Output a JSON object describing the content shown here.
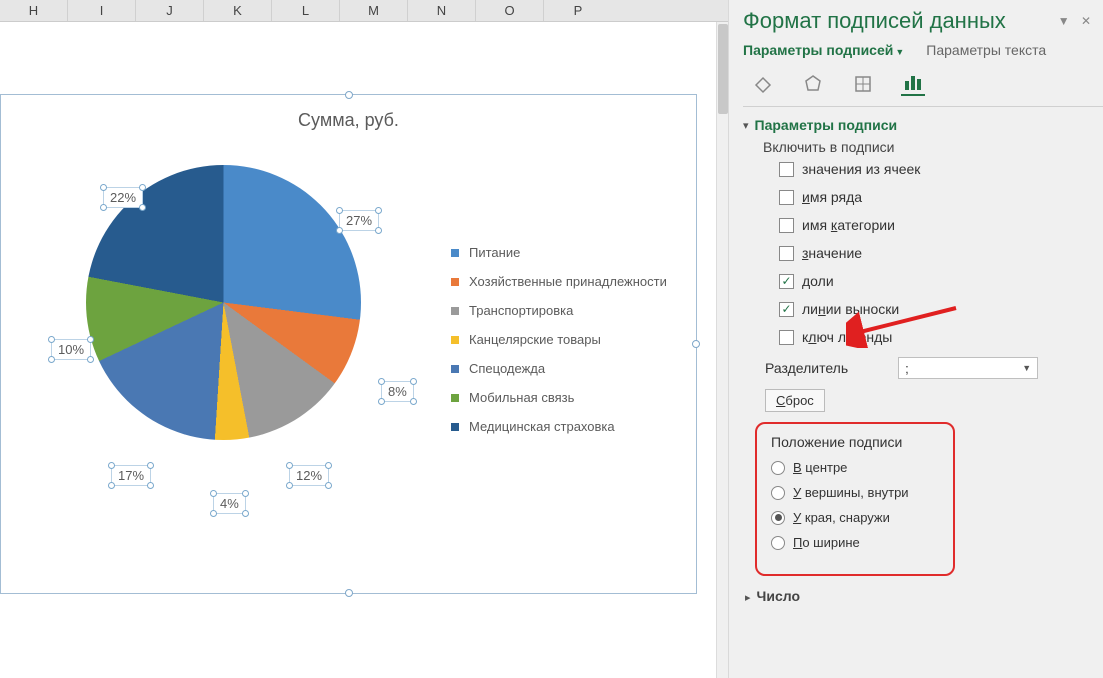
{
  "columns": [
    "H",
    "I",
    "J",
    "K",
    "L",
    "M",
    "N",
    "O",
    "P"
  ],
  "chart_data": {
    "type": "pie",
    "title": "Сумма, руб.",
    "categories": [
      "Питание",
      "Хозяйственные принадлежности",
      "Транспортировка",
      "Канцелярские товары",
      "Спецодежда",
      "Мобильная связь",
      "Медицинская страховка"
    ],
    "values_percent": [
      27,
      8,
      12,
      4,
      17,
      10,
      22
    ],
    "colors": [
      "#4a8ac9",
      "#e9793a",
      "#9a9a9a",
      "#f5bf2a",
      "#4a78b3",
      "#6da33f",
      "#275b8e"
    ],
    "labels": [
      "27%",
      "8%",
      "12%",
      "4%",
      "17%",
      "10%",
      "22%"
    ]
  },
  "panel": {
    "title": "Формат подписей данных",
    "tabs": {
      "options": "Параметры подписей",
      "text": "Параметры текста"
    },
    "section_options": "Параметры подписи",
    "include_label": "Включить в подписи",
    "checks": {
      "from_cells": "значения из ячеек",
      "series_name_pre": "и",
      "series_name_rest": "мя ряда",
      "category_name": "имя ",
      "category_name_u": "к",
      "category_name_post": "атегории",
      "value_pre": "з",
      "value_post": "начение",
      "percent_pre": "д",
      "percent_post": "оли",
      "leader_pre": "ли",
      "leader_u": "н",
      "leader_post": "ии выноски",
      "legend_key_pre": "к",
      "legend_key_u": "л",
      "legend_key_post": "юч легенды"
    },
    "separator_label": "Разделитель",
    "separator_value": ";",
    "reset": "Сброс",
    "position_title": "Положение подписи",
    "positions": {
      "center_pre": "В",
      "center_post": " центре",
      "inside_pre": "У",
      "inside_post": " вершины, внутри",
      "outside_pre": "У",
      "outside_post": " края, снаружи",
      "bestfit_pre": "П",
      "bestfit_post": "о ширине"
    },
    "number_section": "Число"
  }
}
